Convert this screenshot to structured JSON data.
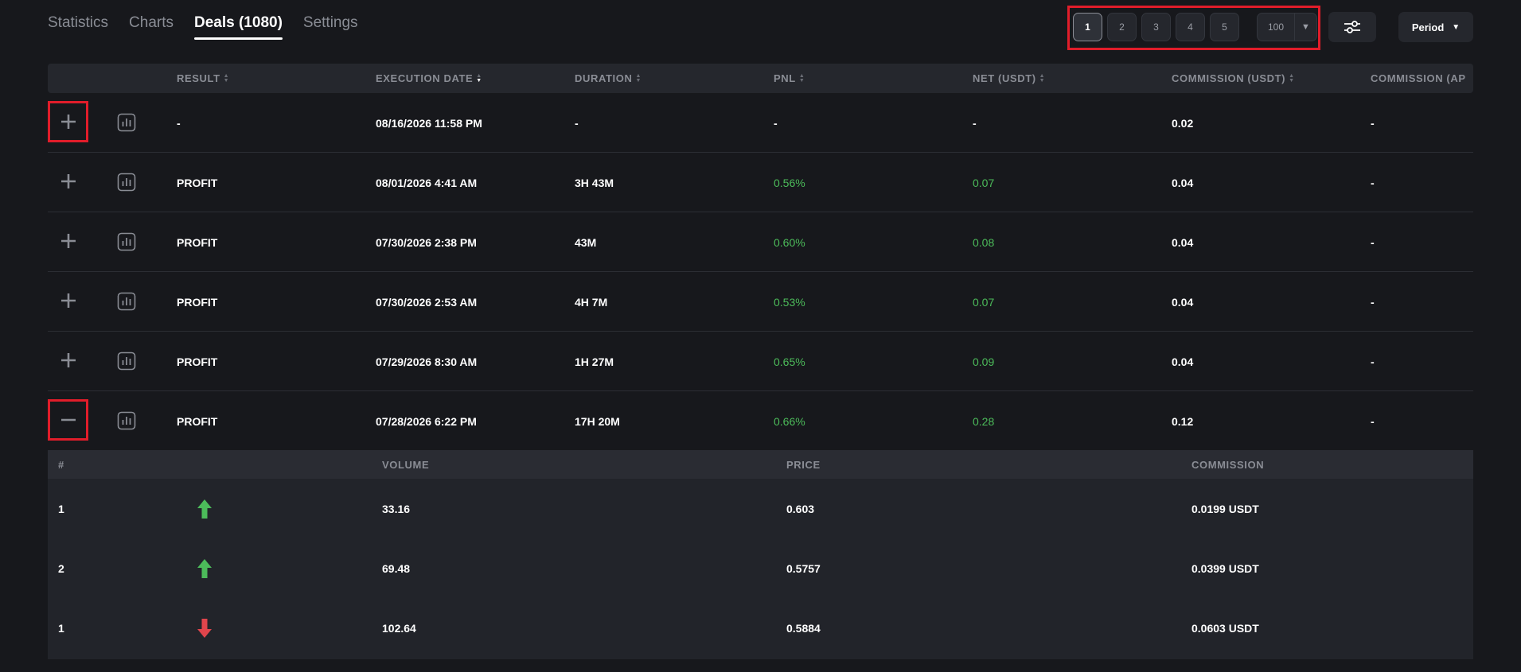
{
  "tabs": [
    {
      "label": "Statistics",
      "active": false
    },
    {
      "label": "Charts",
      "active": false
    },
    {
      "label": "Deals (1080)",
      "active": true
    },
    {
      "label": "Settings",
      "active": false
    }
  ],
  "pagination": {
    "pages": [
      "1",
      "2",
      "3",
      "4",
      "5"
    ],
    "current_page": "1",
    "per_page": "100"
  },
  "period_label": "Period",
  "columns": [
    "RESULT",
    "EXECUTION DATE",
    "DURATION",
    "PNL",
    "NET (USDT)",
    "COMMISSION (USDT)",
    "COMMISSION (AP"
  ],
  "deals": [
    {
      "result": "-",
      "date": "08/16/2026 11:58 PM",
      "duration": "-",
      "pnl": "-",
      "net": "-",
      "commission": "0.02",
      "commission_ap": "-",
      "expanded": false
    },
    {
      "result": "PROFIT",
      "date": "08/01/2026 4:41 AM",
      "duration": "3H 43M",
      "pnl": "0.56%",
      "net": "0.07",
      "commission": "0.04",
      "commission_ap": "-",
      "expanded": false
    },
    {
      "result": "PROFIT",
      "date": "07/30/2026 2:38 PM",
      "duration": "43M",
      "pnl": "0.60%",
      "net": "0.08",
      "commission": "0.04",
      "commission_ap": "-",
      "expanded": false
    },
    {
      "result": "PROFIT",
      "date": "07/30/2026 2:53 AM",
      "duration": "4H 7M",
      "pnl": "0.53%",
      "net": "0.07",
      "commission": "0.04",
      "commission_ap": "-",
      "expanded": false
    },
    {
      "result": "PROFIT",
      "date": "07/29/2026 8:30 AM",
      "duration": "1H 27M",
      "pnl": "0.65%",
      "net": "0.09",
      "commission": "0.04",
      "commission_ap": "-",
      "expanded": false
    },
    {
      "result": "PROFIT",
      "date": "07/28/2026 6:22 PM",
      "duration": "17H 20M",
      "pnl": "0.66%",
      "net": "0.28",
      "commission": "0.12",
      "commission_ap": "-",
      "expanded": true
    }
  ],
  "orders": {
    "columns": [
      "#",
      "VOLUME",
      "PRICE",
      "COMMISSION"
    ],
    "rows": [
      {
        "num": "1",
        "direction": "up",
        "volume": "33.16",
        "price": "0.603",
        "commission": "0.0199 USDT"
      },
      {
        "num": "2",
        "direction": "up",
        "volume": "69.48",
        "price": "0.5757",
        "commission": "0.0399 USDT"
      },
      {
        "num": "1",
        "direction": "down",
        "volume": "102.64",
        "price": "0.5884",
        "commission": "0.0603 USDT"
      }
    ]
  },
  "colors": {
    "background": "#17181c",
    "profit_green": "#4cbb5a",
    "loss_red": "#e0454c",
    "highlight_red": "#e11d2a"
  }
}
